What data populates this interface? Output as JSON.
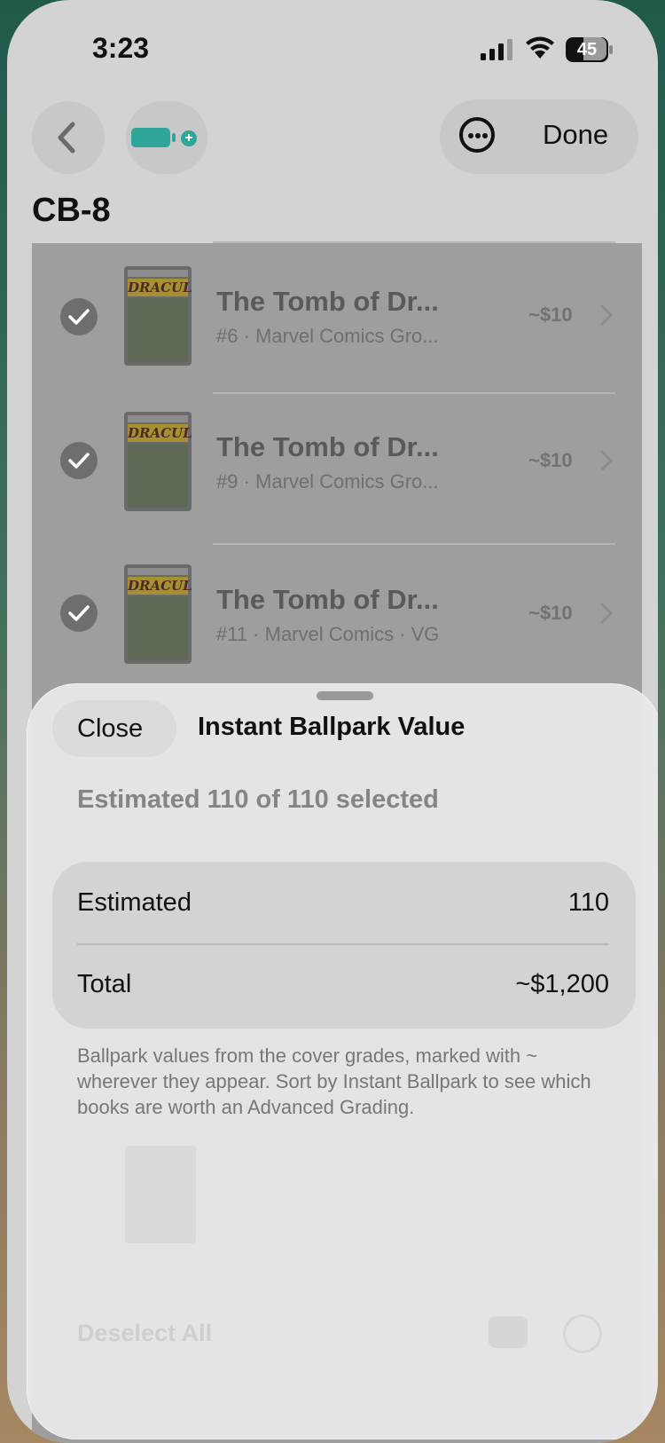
{
  "status_bar": {
    "time": "3:23",
    "battery": "45"
  },
  "nav": {
    "done_label": "Done",
    "page_title": "CB-8"
  },
  "rows": [
    {
      "title": "The Tomb of Dr...",
      "subtitle": "#6 · Marvel Comics Gro...",
      "price": "~$10",
      "cover_logo": "DRACULA"
    },
    {
      "title": "The Tomb of Dr...",
      "subtitle": "#9 · Marvel Comics Gro...",
      "price": "~$10",
      "cover_logo": "DRACULA"
    },
    {
      "title": "The Tomb of Dr...",
      "subtitle": "#11 · Marvel Comics · VG",
      "price": "~$10",
      "cover_logo": "DRACULA"
    }
  ],
  "sheet": {
    "close_label": "Close",
    "title": "Instant Ballpark Value",
    "summary": "Estimated 110 of 110 selected",
    "rows": [
      {
        "label": "Estimated",
        "value": "110"
      },
      {
        "label": "Total",
        "value": "~$1,200"
      }
    ],
    "note": "Ballpark values from the cover grades, marked with ~ wherever they appear. Sort by Instant Ballpark to see which books are worth an Advanced Grading.",
    "toolbar_ghost": "Deselect All"
  },
  "icons": [
    "back-chevron-icon",
    "battery-add-icon",
    "more-icon",
    "checkmark-icon",
    "chevron-right-icon",
    "signal-icon",
    "wifi-icon",
    "battery-icon"
  ],
  "colors": {
    "accent": "#2fa69a"
  }
}
